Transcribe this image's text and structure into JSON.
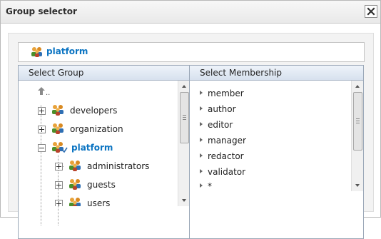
{
  "dialog": {
    "title": "Group selector"
  },
  "current_group": {
    "label": "platform",
    "icon": "group-icon"
  },
  "select_group": {
    "header": "Select Group",
    "up_label": "..",
    "nodes": [
      {
        "label": "developers",
        "expanded": false,
        "active": false
      },
      {
        "label": "organization",
        "expanded": false,
        "active": false
      },
      {
        "label": "platform",
        "expanded": true,
        "active": true
      },
      {
        "label": "administrators",
        "expanded": false,
        "active": false
      },
      {
        "label": "guests",
        "expanded": false,
        "active": false
      },
      {
        "label": "users",
        "expanded": false,
        "active": false
      }
    ]
  },
  "select_membership": {
    "header": "Select Membership",
    "items": [
      "member",
      "author",
      "editor",
      "manager",
      "redactor",
      "validator",
      "*"
    ]
  },
  "colors": {
    "accent": "#0b74c2",
    "header_bg": "#dde6f1"
  }
}
